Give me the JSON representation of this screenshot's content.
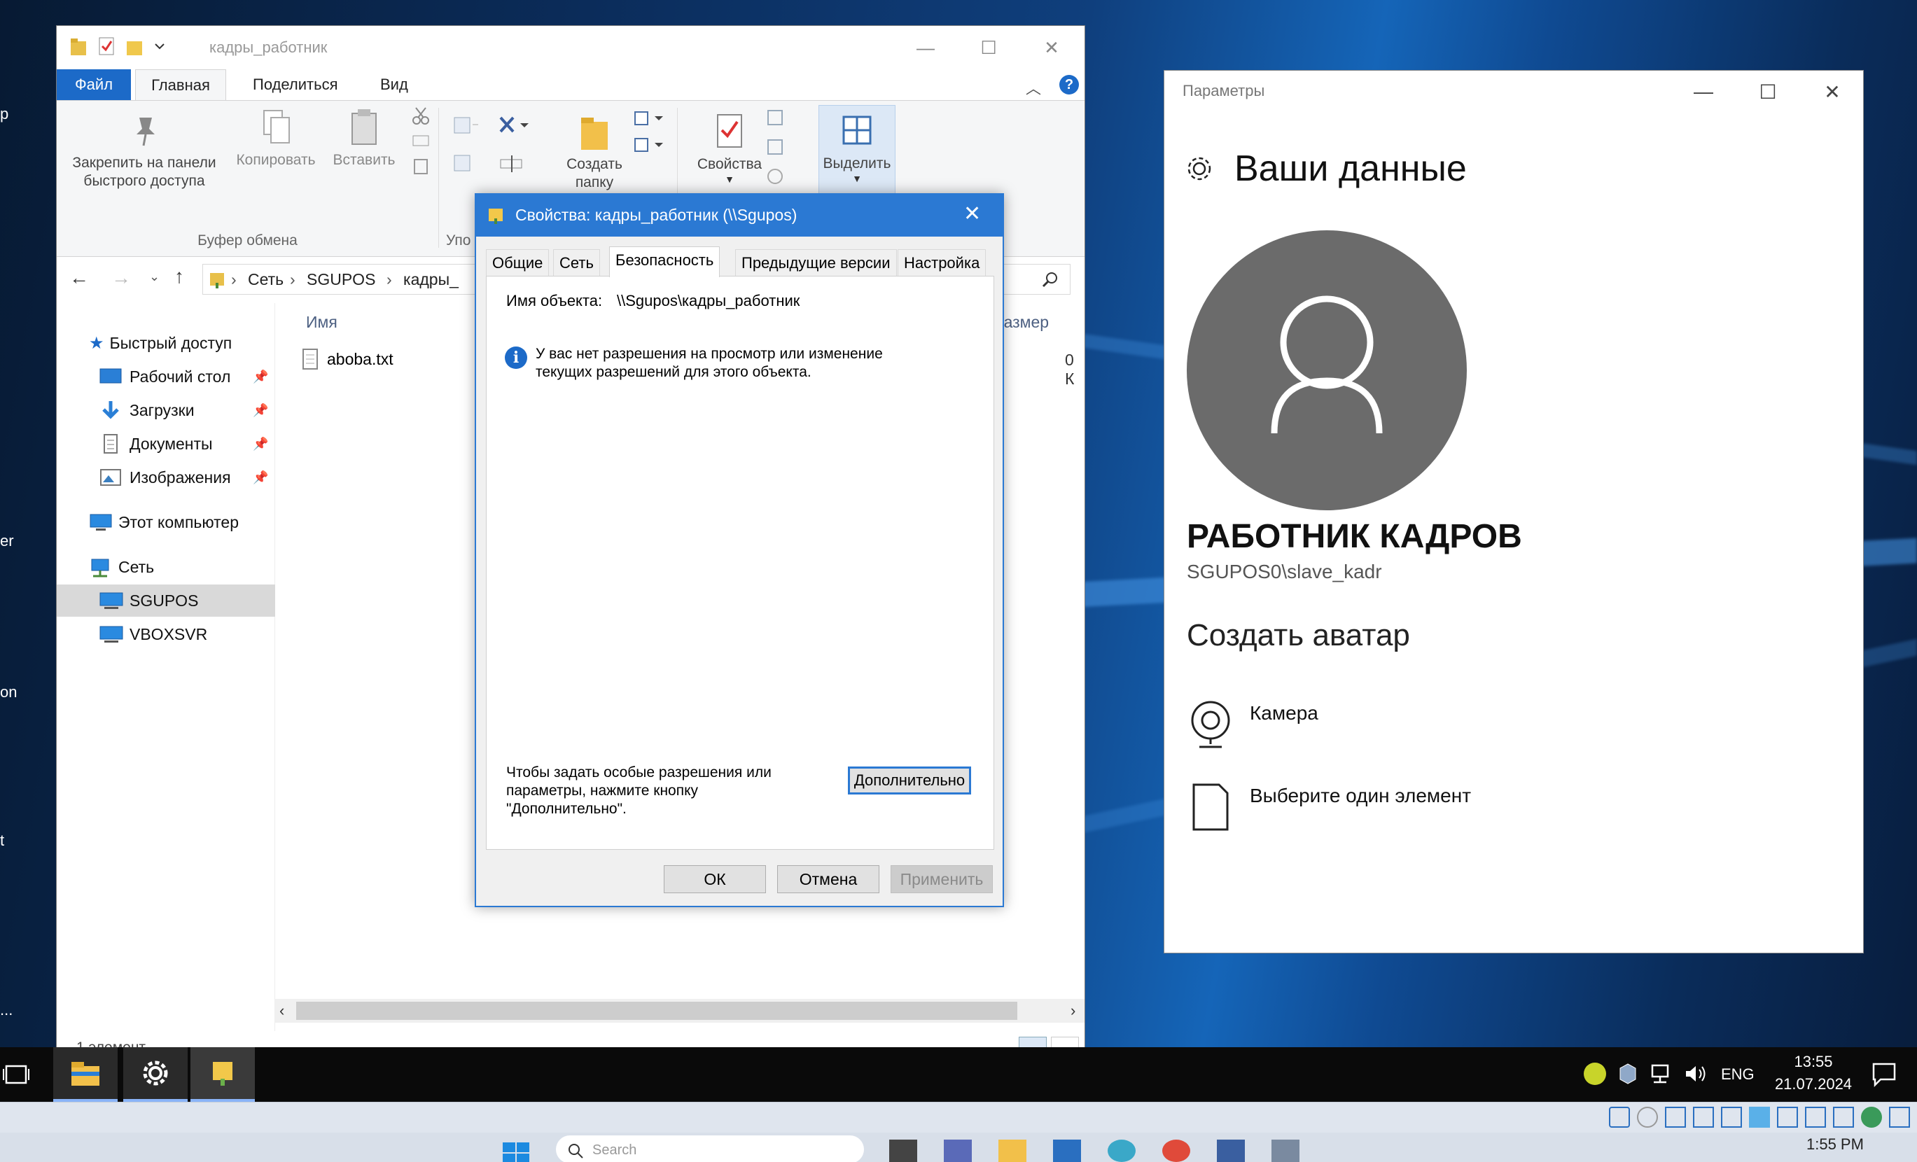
{
  "explorer": {
    "title": "кадры_работник",
    "ribbon_tabs": [
      "Файл",
      "Главная",
      "Поделиться",
      "Вид"
    ],
    "ribbon": {
      "pin_label": "Закрепить на панели быстрого доступа",
      "copy_label": "Копировать",
      "paste_label": "Вставить",
      "clipboard_group": "Буфер обмена",
      "organize_group": "Упо",
      "new_folder_label": "Создать папку",
      "properties_label": "Свойства",
      "select_label": "Выделить"
    },
    "breadcrumb": [
      "Сеть",
      "SGUPOS",
      "кадры_"
    ],
    "nav": {
      "quick_access": "Быстрый доступ",
      "desktop": "Рабочий стол",
      "downloads": "Загрузки",
      "documents": "Документы",
      "pictures": "Изображения",
      "this_pc": "Этот компьютер",
      "network": "Сеть",
      "sgupos": "SGUPOS",
      "vboxsvr": "VBOXSVR"
    },
    "columns": {
      "name": "Имя",
      "size": "Размер"
    },
    "files": [
      {
        "name": "aboba.txt",
        "size": "0 К"
      }
    ],
    "status": "1 элемент"
  },
  "dialog": {
    "title": "Свойства: кадры_работник (\\\\Sgupos)",
    "tabs": [
      "Общие",
      "Сеть",
      "Безопасность",
      "Предыдущие версии",
      "Настройка"
    ],
    "object_label": "Имя объекта:",
    "object_value": "\\\\Sgupos\\кадры_работник",
    "info_line1": "У вас нет разрешения на просмотр или изменение",
    "info_line2": "текущих разрешений для этого объекта.",
    "hint_line1": "Чтобы задать особые разрешения или",
    "hint_line2": "параметры, нажмите кнопку",
    "hint_line3": "\"Дополнительно\".",
    "advanced_button": "Дополнительно",
    "ok_button": "ОК",
    "cancel_button": "Отмена",
    "apply_button": "Применить"
  },
  "settings": {
    "window_title": "Параметры",
    "page_title": "Ваши данные",
    "user_name": "РАБОТНИК КАДРОВ",
    "account": "SGUPOS0\\slave_kadr",
    "create_avatar": "Создать аватар",
    "camera": "Камера",
    "choose_item": "Выберите один элемент"
  },
  "desktop_edge_labels": [
    "p",
    "er",
    "on",
    "t",
    "..."
  ],
  "taskbar": {
    "language": "ENG",
    "time": "13:55",
    "date": "21.07.2024"
  },
  "host": {
    "time": "1:55 PM",
    "search_placeholder": "Search"
  },
  "colors": {
    "accent": "#2b79d3",
    "file_tab": "#1c6ac8",
    "avatar_bg": "#6b6b6b"
  }
}
